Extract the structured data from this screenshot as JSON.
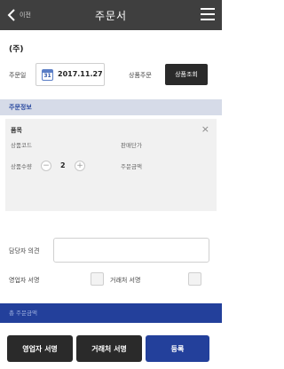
{
  "header": {
    "back_label": "이전",
    "title": "주문서"
  },
  "company": "(주)",
  "order": {
    "date_label": "주문일",
    "date_icon_day": "31",
    "date_value": "2017.11.27",
    "product_order_label": "상품주문",
    "lookup_button": "상품조회"
  },
  "section": {
    "order_info": "주문정보"
  },
  "item": {
    "name": "품목",
    "code_label": "상품코드",
    "price_label": "판매단가",
    "qty_label": "상품수량",
    "qty_value": "2",
    "amount_label": "주문금액",
    "minus": "−",
    "plus": "+",
    "close": "×"
  },
  "opinion": {
    "label": "담당자 의견",
    "placeholder": ""
  },
  "signature": {
    "seller_label": "영업자 서명",
    "buyer_label": "거래처 서명"
  },
  "total": {
    "label": "총 주문금액"
  },
  "footer": {
    "seller_sign_button": "영업자 서명",
    "buyer_sign_button": "거래처 서명",
    "register_button": "등록"
  },
  "colors": {
    "header_bg": "#3f3f3f",
    "section_bg": "#d6dbe8",
    "accent_blue": "#23409b",
    "dark_button": "#2a2a2a"
  },
  "icons": {
    "back": "chevron-left-icon",
    "menu": "hamburger-menu-icon",
    "calendar": "calendar-icon",
    "close": "close-icon"
  }
}
